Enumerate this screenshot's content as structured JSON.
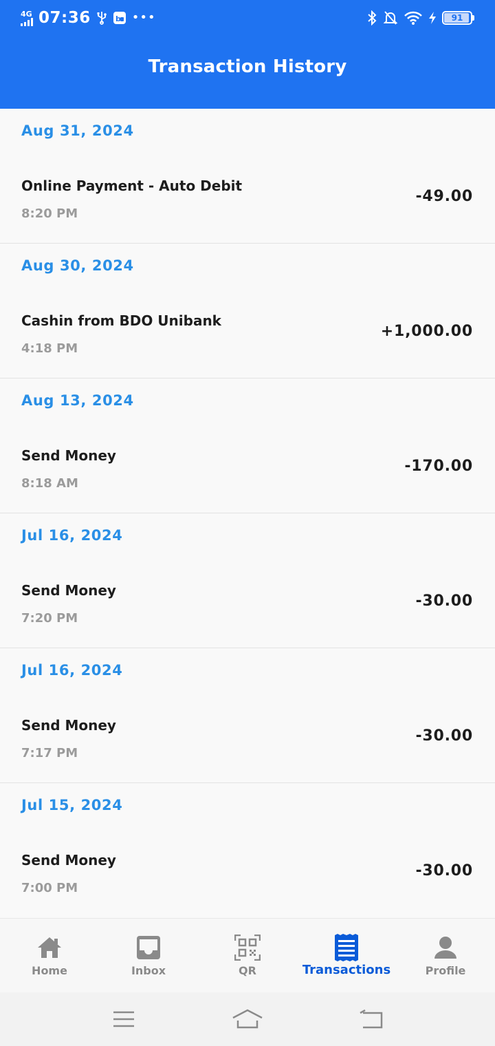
{
  "status_bar": {
    "network": "4G",
    "time": "07:36",
    "battery": "91"
  },
  "header": {
    "title": "Transaction History"
  },
  "groups": [
    {
      "date": "Aug 31, 2024",
      "title": "Online Payment - Auto Debit",
      "time": "8:20 PM",
      "amount": "-49.00"
    },
    {
      "date": "Aug 30, 2024",
      "title": "Cashin from BDO Unibank",
      "time": "4:18 PM",
      "amount": "+1,000.00"
    },
    {
      "date": "Aug 13, 2024",
      "title": "Send Money",
      "time": "8:18 AM",
      "amount": "-170.00"
    },
    {
      "date": "Jul 16, 2024",
      "title": "Send Money",
      "time": "7:20 PM",
      "amount": "-30.00"
    },
    {
      "date": "Jul 16, 2024",
      "title": "Send Money",
      "time": "7:17 PM",
      "amount": "-30.00"
    },
    {
      "date": "Jul 15, 2024",
      "title": "Send Money",
      "time": "7:00 PM",
      "amount": "-30.00"
    }
  ],
  "bottom_nav": [
    {
      "label": "Home",
      "icon": "home-icon",
      "active": false
    },
    {
      "label": "Inbox",
      "icon": "inbox-icon",
      "active": false
    },
    {
      "label": "QR",
      "icon": "qr-icon",
      "active": false
    },
    {
      "label": "Transactions",
      "icon": "receipt-icon",
      "active": true
    },
    {
      "label": "Profile",
      "icon": "profile-icon",
      "active": false
    }
  ],
  "colors": {
    "header": "#1f73f1",
    "date": "#2a8fe6",
    "active_nav": "#0a5bd8",
    "inactive_nav": "#8a8a8a"
  }
}
